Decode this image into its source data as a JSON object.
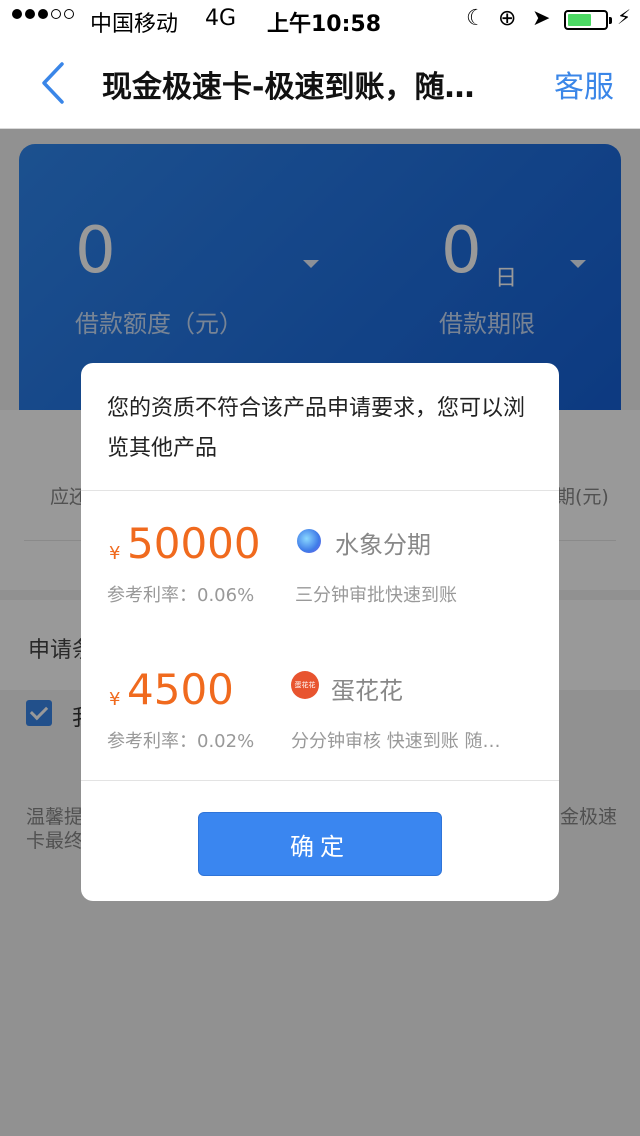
{
  "status_bar": {
    "signal": [
      1,
      1,
      1,
      0,
      0
    ],
    "carrier": "中国移动",
    "network": "4G",
    "time": "上午10:58",
    "battery_level": 0.65
  },
  "nav": {
    "title": "现金极速卡-极速到账，随…",
    "service_label": "客服"
  },
  "loan_card": {
    "amount_value": "0",
    "amount_label": "借款额度（元）",
    "term_value": "0",
    "term_unit": "日",
    "term_label": "借款期限"
  },
  "background_page": {
    "repay_label_fragment": "应还",
    "period_label_fragment": "期(元)",
    "apply_label_fragment": "申请条",
    "agree_fragment": "我",
    "tip_fragment_1": "温馨提",
    "tip_fragment_2": "卡最终",
    "tip_fragment_3": "金极速"
  },
  "modal": {
    "message": "您的资质不符合该产品申请要求，您可以浏览其他产品",
    "currency": "¥",
    "products": [
      {
        "amount": "50000",
        "rate": "参考利率：0.06%",
        "name": "水象分期",
        "description": "三分钟审批快速到账",
        "icon": "water-drop-logo-icon"
      },
      {
        "amount": "4500",
        "rate": "参考利率：0.02%",
        "name": "蛋花花",
        "description": "分分钟审核 快速到账 随…",
        "icon": "egg-logo-icon",
        "logo_text": "蛋花花"
      }
    ],
    "confirm_label": "确定"
  },
  "colors": {
    "accent": "#3a86e8",
    "price": "#f06a1e",
    "card_gradient_start": "#2f86ee",
    "card_gradient_end": "#1560d6"
  }
}
